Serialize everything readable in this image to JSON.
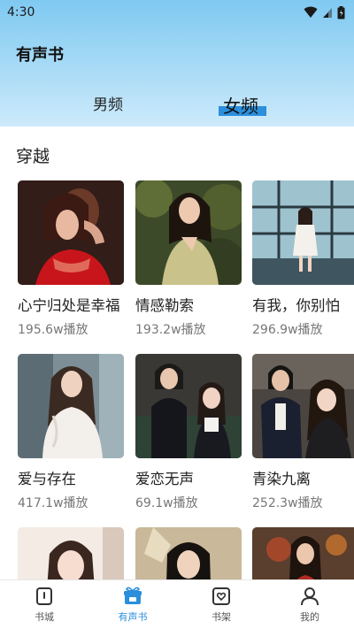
{
  "status_bar": {
    "time": "4:30"
  },
  "header": {
    "title": "有声书"
  },
  "tabs": [
    {
      "label": "男频",
      "active": false
    },
    {
      "label": "女频",
      "active": true
    }
  ],
  "accent_color": "#2b8fdc",
  "section": {
    "title": "穿越",
    "books": [
      {
        "title": "心宁归处是幸福",
        "plays": "195.6w播放"
      },
      {
        "title": "情感勒索",
        "plays": "193.2w播放"
      },
      {
        "title": "有我，你别怕",
        "plays": "296.9w播放"
      },
      {
        "title": "爱与存在",
        "plays": "417.1w播放"
      },
      {
        "title": "爱恋无声",
        "plays": "69.1w播放"
      },
      {
        "title": "青染九离",
        "plays": "252.3w播放"
      },
      {
        "title": "",
        "plays": ""
      },
      {
        "title": "",
        "plays": ""
      },
      {
        "title": "",
        "plays": ""
      }
    ]
  },
  "bottom_nav": [
    {
      "label": "书城",
      "icon": "bookstore-icon",
      "active": false
    },
    {
      "label": "有声书",
      "icon": "gift-icon",
      "active": true
    },
    {
      "label": "书架",
      "icon": "bookshelf-icon",
      "active": false
    },
    {
      "label": "我的",
      "icon": "profile-icon",
      "active": false
    }
  ]
}
